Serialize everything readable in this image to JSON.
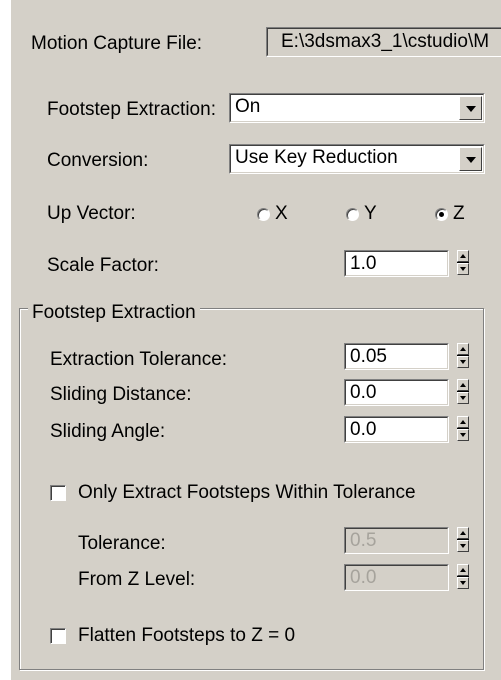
{
  "mocap": {
    "label": "Motion Capture File:",
    "path": "E:\\3dsmax3_1\\cstudio\\M"
  },
  "footstep_extraction": {
    "label": "Footstep Extraction:",
    "value": "On"
  },
  "conversion": {
    "label": "Conversion:",
    "value": "Use Key Reduction"
  },
  "up_vector": {
    "label": "Up Vector:",
    "options": [
      "X",
      "Y",
      "Z"
    ],
    "selected": "Z"
  },
  "scale_factor": {
    "label": "Scale Factor:",
    "value": "1.0"
  },
  "group": {
    "title": "Footstep Extraction",
    "extraction_tolerance": {
      "label": "Extraction Tolerance:",
      "value": "0.05"
    },
    "sliding_distance": {
      "label": "Sliding Distance:",
      "value": "0.0"
    },
    "sliding_angle": {
      "label": "Sliding Angle:",
      "value": "0.0"
    },
    "only_extract": {
      "label": "Only Extract Footsteps Within Tolerance",
      "checked": false
    },
    "tolerance": {
      "label": "Tolerance:",
      "value": "0.5",
      "disabled": true
    },
    "from_z_level": {
      "label": "From Z Level:",
      "value": "0.0",
      "disabled": true
    },
    "flatten": {
      "label": "Flatten Footsteps to Z = 0",
      "checked": false
    }
  }
}
